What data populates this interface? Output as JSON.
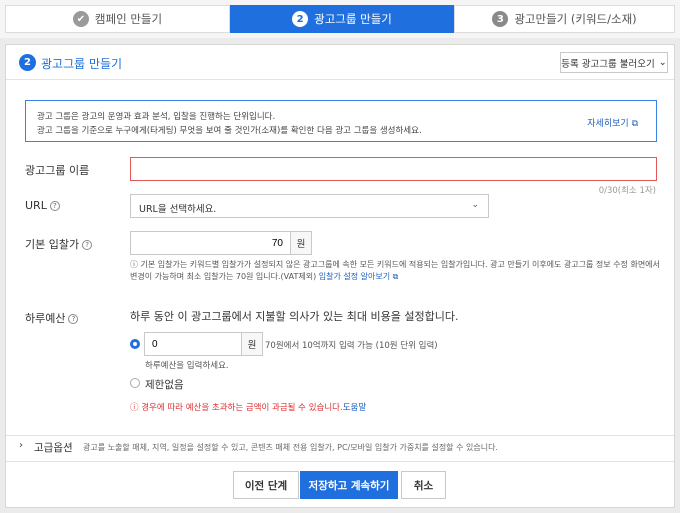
{
  "stepper": {
    "step1": {
      "num": "✔",
      "label": "캠페인 만들기"
    },
    "step2": {
      "num": "2",
      "label": "광고그룹 만들기"
    },
    "step3": {
      "num": "3",
      "label": "광고만들기 (키워드/소재)"
    }
  },
  "header": {
    "badge": "2",
    "title": "광고그룹 만들기",
    "load_button": "등록 광고그룹 불러오기",
    "load_icon": "chevron-down-icon"
  },
  "info": {
    "line1": "광고 그룹은 광고의 운영과 효과 분석, 입찰을 진행하는 단위입니다.",
    "line2": "광고 그룹을 기준으로 누구에게(타게팅) 무엇을 보여 줄 것인가(소재)를 확인한 다음 광고 그룹을 생성하세요.",
    "detail_link": "자세히보기"
  },
  "form": {
    "name_label": "광고그룹 이름",
    "name_value": "",
    "name_counter": "0/30(최소 1자)",
    "url_label": "URL",
    "url_placeholder": "URL을 선택하세요.",
    "bid_label": "기본 입찰가",
    "bid_value": "70",
    "bid_unit": "원",
    "bid_note_line1": "기본 입찰가는 키워드별 입찰가가 설정되지 않은 광고그룹에 속한 모든 키워드에 적용되는 입찰가입니다. 광고 만들기 이후에도 광고그룹 정보 수정 화면에서",
    "bid_note_line2": "변경이 가능하며 최소 입찰가는 70원 입니다.(VAT제외)",
    "bid_note_link": "입찰가 설정 알아보기",
    "budget_label": "하루예산",
    "budget_desc": "하루 동안 이 광고그룹에서 지불할 의사가 있는 최대 비용을 설정합니다.",
    "budget_value": "0",
    "budget_unit": "원",
    "budget_hint": "70원에서 10억까지 입력 가능 (10원 단위 입력)",
    "budget_error": "하루예산을 입력하세요.",
    "unlimited_label": "제한없음",
    "warning_text": "경우에 따라 예산을 초과하는 금액이 과금될 수 있습니다.",
    "warning_link": "도움말"
  },
  "advanced": {
    "title": "고급옵션",
    "desc": "광고를 노출할 매체, 지역, 일정을 설정할 수 있고, 콘텐츠 매체 전용 입찰가, PC/모바일 입찰가 가중치를 설정할 수 있습니다."
  },
  "footer": {
    "prev": "이전 단계",
    "save": "저장하고 계속하기",
    "cancel": "취소"
  },
  "colors": {
    "accent": "#1f6fde",
    "error": "#e35757"
  }
}
